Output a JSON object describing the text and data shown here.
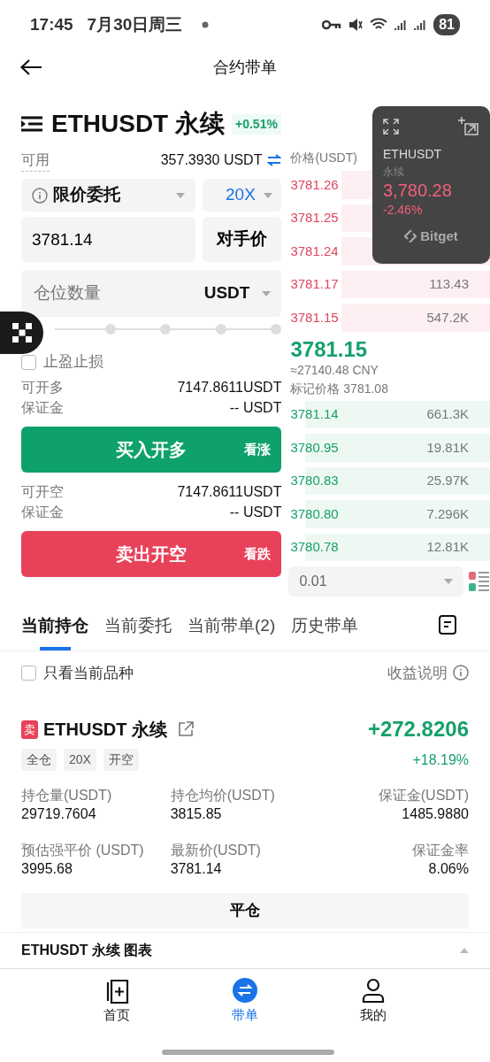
{
  "status_bar": {
    "time": "17:45",
    "date": "7月30日周三",
    "battery": "81"
  },
  "header": {
    "title": "合约带单"
  },
  "instrument": {
    "symbol": "ETHUSDT 永续",
    "change": "+0.51%"
  },
  "available": {
    "label": "可用",
    "value": "357.3930 USDT"
  },
  "order_form": {
    "order_type": "限价委托",
    "leverage": "20X",
    "price": "3781.14",
    "counter_price": "对手价",
    "quantity_placeholder": "仓位数量",
    "unit": "USDT",
    "tpsl": {
      "label": "止盈止损",
      "checked": false
    }
  },
  "long": {
    "rows": [
      {
        "label": "可开多",
        "value": "7147.8611USDT"
      },
      {
        "label": "保证金",
        "value": "-- USDT"
      }
    ],
    "button": {
      "label": "买入开多",
      "hint": "看涨"
    }
  },
  "short": {
    "rows": [
      {
        "label": "可开空",
        "value": "7147.8611USDT"
      },
      {
        "label": "保证金",
        "value": "-- USDT"
      }
    ],
    "button": {
      "label": "卖出开空",
      "hint": "看跌"
    }
  },
  "order_book": {
    "price_header": "价格(USDT)",
    "asks": [
      {
        "price": "3781.26"
      },
      {
        "price": "3781.25"
      },
      {
        "price": "3781.24"
      },
      {
        "price": "3781.17",
        "quantity": "113.43"
      },
      {
        "price": "3781.15",
        "quantity": "547.2K"
      }
    ],
    "last_price": "3781.15",
    "cny": "≈27140.48 CNY",
    "mark_price": "标记价格 3781.08",
    "bids": [
      {
        "price": "3781.14",
        "quantity": "661.3K"
      },
      {
        "price": "3780.95",
        "quantity": "19.81K"
      },
      {
        "price": "3780.83",
        "quantity": "25.97K"
      },
      {
        "price": "3780.80",
        "quantity": "7.296K"
      },
      {
        "price": "3780.78",
        "quantity": "12.81K"
      }
    ],
    "precision": "0.01"
  },
  "floating_ticker": {
    "symbol": "ETHUSDT",
    "type": "永续",
    "price": "3,780.28",
    "change": "-2.46%",
    "brand": "Bitget"
  },
  "tabs": [
    {
      "label": "当前持仓",
      "selected": true
    },
    {
      "label": "当前委托",
      "selected": false
    },
    {
      "label": "当前带单(2)",
      "selected": false
    },
    {
      "label": "历史带单",
      "selected": false
    }
  ],
  "filter": {
    "label": "只看当前品种",
    "checked": false
  },
  "pnl_info": "收益说明",
  "position": {
    "side": "卖",
    "symbol": "ETHUSDT 永续",
    "pnl": "+272.8206",
    "pnl_percent": "+18.19%",
    "tags": [
      "全仓",
      "20X",
      "开空"
    ],
    "fields": [
      {
        "label": "持仓量(USDT)",
        "value": "29719.7604"
      },
      {
        "label": "持仓均价(USDT)",
        "value": "3815.85"
      },
      {
        "label": "保证金(USDT)",
        "value": "1485.9880"
      },
      {
        "label": "预估强平价 (USDT)",
        "value": "3995.68"
      },
      {
        "label": "最新价(USDT)",
        "value": "3781.14"
      },
      {
        "label": "保证金率",
        "value": "8.06%"
      }
    ],
    "close_button": "平仓"
  },
  "chart_bar": {
    "label": "ETHUSDT 永续 图表"
  },
  "bottom_nav": [
    {
      "label": "首页",
      "selected": false
    },
    {
      "label": "带单",
      "selected": true
    },
    {
      "label": "我的",
      "selected": false
    }
  ]
}
